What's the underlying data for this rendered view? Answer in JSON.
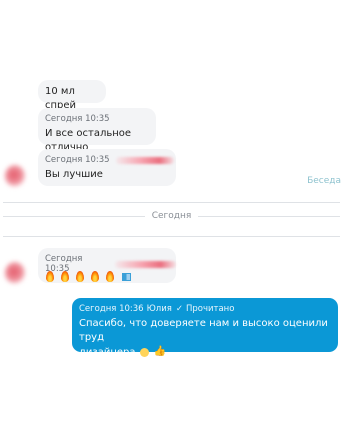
{
  "messages": [
    {
      "text": "10 мл спрей"
    },
    {
      "time": "Сегодня 10:35",
      "text": "И все остальное отлично"
    },
    {
      "time": "Сегодня 10:35",
      "text": "Вы лучшие"
    }
  ],
  "chat_link_label": "Беседа",
  "date_separator_label": "Сегодня",
  "reaction_message": {
    "time": "Сегодня 10:35",
    "emoji_names": [
      "fire-emoji",
      "fire-emoji",
      "fire-emoji",
      "fire-emoji",
      "fire-emoji",
      "book-emoji"
    ]
  },
  "outgoing_message": {
    "time": "Сегодня 10:36",
    "author": "Юлия",
    "status": "Прочитано",
    "text_line1": "Спасибо, что доверяете нам и высоко оценили труд",
    "text_line2": "дизайнера",
    "emoji_names": [
      "smiling-face-emoji",
      "thumbs-up-emoji"
    ]
  },
  "colors": {
    "outgoing_bubble": "#0b98d6",
    "incoming_bubble": "#f3f4f6",
    "link": "#8fc3cf"
  }
}
